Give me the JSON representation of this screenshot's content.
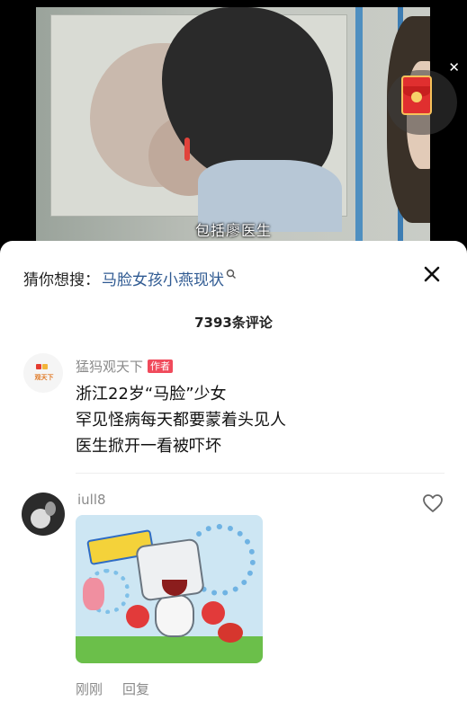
{
  "video": {
    "subtitle": "包括廖医生"
  },
  "search_suggestion": {
    "prefix": "猜你想搜：",
    "term": "马脸女孩小燕现状"
  },
  "comments": {
    "count_label": "7393条评论"
  },
  "author_post": {
    "avatar_text": "观天下",
    "name": "猛犸观天下",
    "badge": "作者",
    "lines": [
      "浙江22岁“马脸”少女",
      "罕见怪病每天都要蒙着头见人",
      "医生掀开一看被吓坏"
    ]
  },
  "reply_comment": {
    "username": "iull8",
    "time": "刚刚",
    "reply_label": "回复"
  },
  "colors": {
    "search_term": "#2f5a92",
    "author_badge": "#f04a5b",
    "muted_text": "#8a8a8a"
  }
}
